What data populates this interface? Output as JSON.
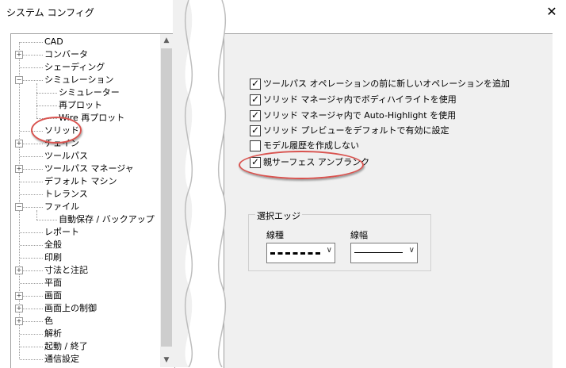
{
  "window": {
    "title": "システム コンフィグ",
    "close_glyph": "✕"
  },
  "tree": {
    "items": [
      {
        "label": "CAD",
        "expander": "",
        "depth": 0
      },
      {
        "label": "コンバータ",
        "expander": "+",
        "depth": 0
      },
      {
        "label": "シェーディング",
        "expander": "",
        "depth": 0
      },
      {
        "label": "シミュレーション",
        "expander": "−",
        "depth": 0
      },
      {
        "label": "シミュレーター",
        "expander": "",
        "depth": 1
      },
      {
        "label": "再プロット",
        "expander": "",
        "depth": 1
      },
      {
        "label": "Wire 再プロット",
        "expander": "",
        "depth": 1
      },
      {
        "label": "ソリッド",
        "expander": "",
        "depth": 0
      },
      {
        "label": "チェイン",
        "expander": "+",
        "depth": 0
      },
      {
        "label": "ツールパス",
        "expander": "",
        "depth": 0
      },
      {
        "label": "ツールパス マネージャ",
        "expander": "+",
        "depth": 0
      },
      {
        "label": "デフォルト マシン",
        "expander": "",
        "depth": 0
      },
      {
        "label": "トレランス",
        "expander": "",
        "depth": 0
      },
      {
        "label": "ファイル",
        "expander": "−",
        "depth": 0
      },
      {
        "label": "自動保存 / バックアップ",
        "expander": "",
        "depth": 1
      },
      {
        "label": "レポート",
        "expander": "",
        "depth": 0
      },
      {
        "label": "全般",
        "expander": "",
        "depth": 0
      },
      {
        "label": "印刷",
        "expander": "",
        "depth": 0
      },
      {
        "label": "寸法と注記",
        "expander": "+",
        "depth": 0
      },
      {
        "label": "平面",
        "expander": "",
        "depth": 0
      },
      {
        "label": "画面",
        "expander": "+",
        "depth": 0
      },
      {
        "label": "画面上の制御",
        "expander": "+",
        "depth": 0
      },
      {
        "label": "色",
        "expander": "+",
        "depth": 0
      },
      {
        "label": "解析",
        "expander": "",
        "depth": 0
      },
      {
        "label": "起動 / 終了",
        "expander": "",
        "depth": 0
      },
      {
        "label": "通信設定",
        "expander": "",
        "depth": 0
      }
    ],
    "scroll_up_glyph": "▲",
    "scroll_down_glyph": "▼"
  },
  "options": [
    {
      "label": "ツールパス オペレーションの前に新しいオペレーションを追加",
      "checked": true
    },
    {
      "label": "ソリッド マネージャ内でボディハイライトを使用",
      "checked": true
    },
    {
      "label": "ソリッド マネージャ内で Auto-Highlight を使用",
      "checked": true
    },
    {
      "label": "ソリッド プレビューをデフォルトで有効に設定",
      "checked": true
    },
    {
      "label": "モデル履歴を作成しない",
      "checked": false
    },
    {
      "label": "親サーフェス アンブランク",
      "checked": true
    }
  ],
  "edge_group": {
    "title": "選択エッジ",
    "line_type_label": "線種",
    "line_width_label": "線幅",
    "arrow_glyph": "∨"
  },
  "colors": {
    "callout": "#d9534f",
    "panel_bg": "#f0f0f0"
  }
}
